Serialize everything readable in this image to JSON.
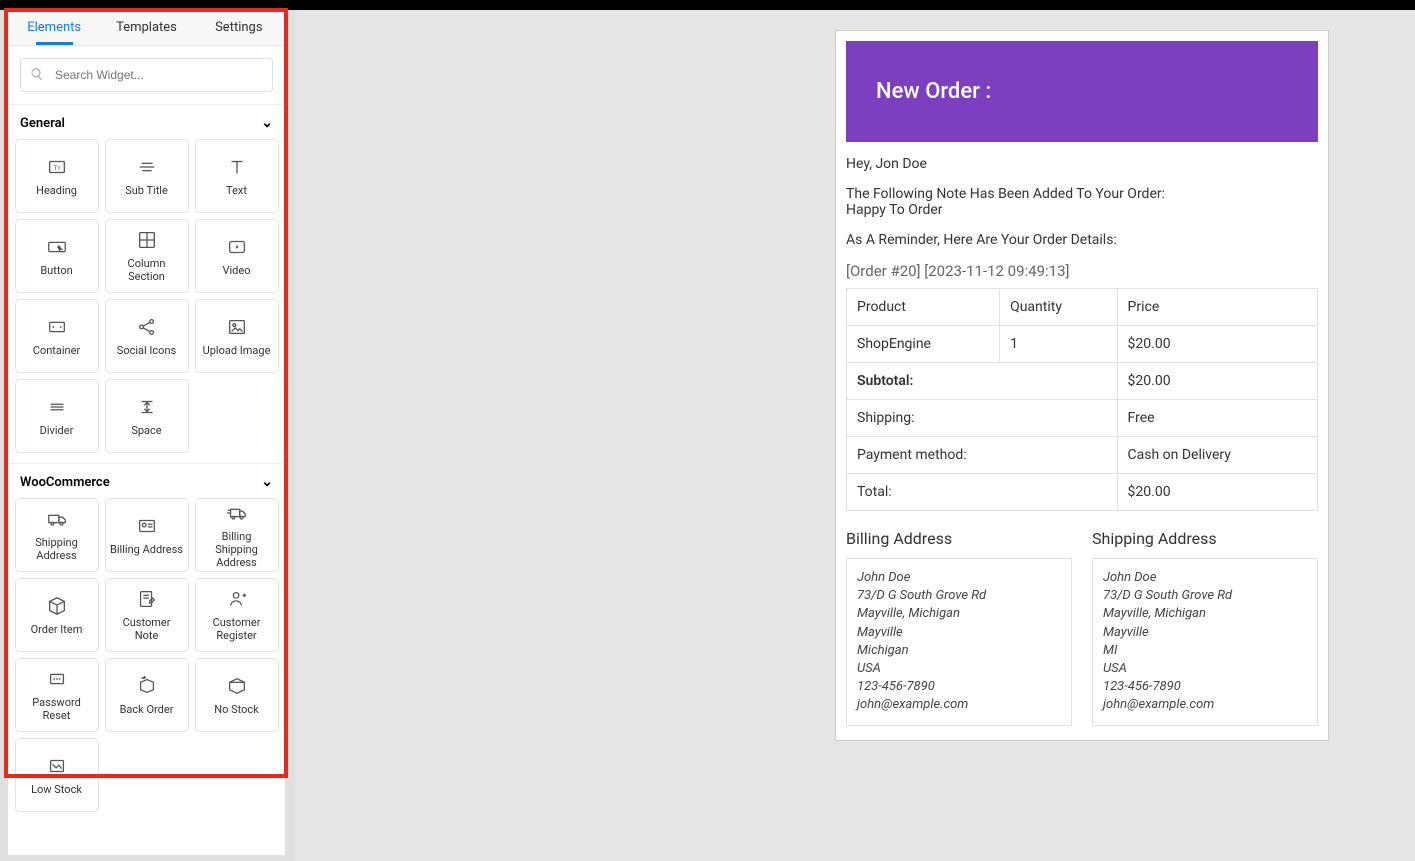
{
  "tabs": {
    "elements": "Elements",
    "templates": "Templates",
    "settings": "Settings"
  },
  "search": {
    "placeholder": "Search Widget..."
  },
  "cats": {
    "general": "General",
    "woo": "WooCommerce"
  },
  "widgets": {
    "heading": "Heading",
    "subtitle": "Sub Title",
    "text": "Text",
    "button": "Button",
    "column": "Column Section",
    "video": "Video",
    "container": "Container",
    "social": "Social Icons",
    "upload": "Upload Image",
    "divider": "Divider",
    "space": "Space",
    "ship_addr": "Shipping Address",
    "bill_addr": "Billing Address",
    "bs_addr": "Billing Shipping Address",
    "order_item": "Order Item",
    "cust_note": "Customer Note",
    "cust_reg": "Customer Register",
    "pw_reset": "Password Reset",
    "back_order": "Back Order",
    "no_stock": "No Stock",
    "low_stock": "Low Stock"
  },
  "email": {
    "title": "New Order :",
    "greeting": "Hey, Jon Doe",
    "note_intro": "The Following Note Has Been Added To Your Order:",
    "note_body": "Happy To Order",
    "reminder": "As A Reminder, Here Are Your Order Details:",
    "meta": "[Order #20] [2023-11-12 09:49:13]",
    "th_product": "Product",
    "th_qty": "Quantity",
    "th_price": "Price",
    "row_product": "ShopEngine",
    "row_qty": "1",
    "row_price": "$20.00",
    "subtotal_l": "Subtotal:",
    "subtotal_v": "$20.00",
    "shipping_l": "Shipping:",
    "shipping_v": "Free",
    "payment_l": "Payment method:",
    "payment_v": "Cash on Delivery",
    "total_l": "Total:",
    "total_v": "$20.00",
    "bill_h": "Billing Address",
    "ship_h": "Shipping Address",
    "bill_lines": [
      "John Doe",
      "73/D G South Grove Rd",
      "Mayville, Michigan",
      "Mayville",
      "Michigan",
      "USA",
      "123-456-7890",
      "john@example.com"
    ],
    "ship_lines": [
      "John Doe",
      "73/D G South Grove Rd",
      "Mayville, Michigan",
      "Mayville",
      "MI",
      "USA",
      "123-456-7890",
      "john@example.com"
    ]
  }
}
